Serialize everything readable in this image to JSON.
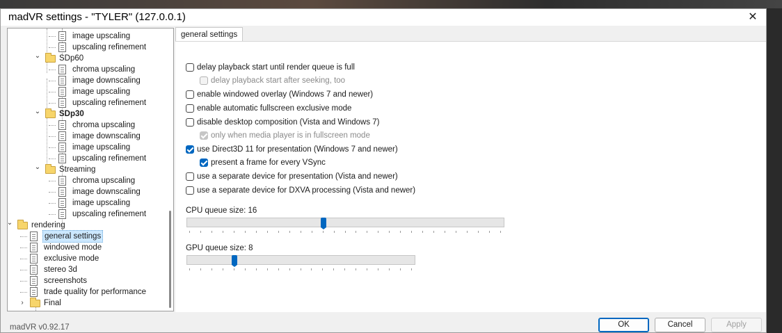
{
  "window": {
    "title": "madVR settings - \"TYLER\" (127.0.0.1)"
  },
  "icons": {
    "close": "close-icon",
    "folder": "folder-icon",
    "document": "document-icon",
    "expand": "chevron-down-icon",
    "collapsed": "chevron-right-icon"
  },
  "tree": {
    "items": [
      {
        "label": "image upscaling",
        "kind": "doc"
      },
      {
        "label": "upscaling refinement",
        "kind": "doc"
      },
      {
        "label": "SDp60",
        "kind": "folder",
        "expanded": true
      },
      {
        "label": "chroma upscaling",
        "kind": "doc"
      },
      {
        "label": "image downscaling",
        "kind": "doc"
      },
      {
        "label": "image upscaling",
        "kind": "doc"
      },
      {
        "label": "upscaling refinement",
        "kind": "doc"
      },
      {
        "label": "SDp30",
        "kind": "folder",
        "expanded": true,
        "bold": true
      },
      {
        "label": "chroma upscaling",
        "kind": "doc"
      },
      {
        "label": "image downscaling",
        "kind": "doc"
      },
      {
        "label": "image upscaling",
        "kind": "doc"
      },
      {
        "label": "upscaling refinement",
        "kind": "doc"
      },
      {
        "label": "Streaming",
        "kind": "folder",
        "expanded": true
      },
      {
        "label": "chroma upscaling",
        "kind": "doc"
      },
      {
        "label": "image downscaling",
        "kind": "doc"
      },
      {
        "label": "image upscaling",
        "kind": "doc"
      },
      {
        "label": "upscaling refinement",
        "kind": "doc"
      },
      {
        "label": "rendering",
        "kind": "folder",
        "expanded": true
      },
      {
        "label": "general settings",
        "kind": "doc",
        "selected": true
      },
      {
        "label": "windowed mode",
        "kind": "doc"
      },
      {
        "label": "exclusive mode",
        "kind": "doc"
      },
      {
        "label": "stereo 3d",
        "kind": "doc"
      },
      {
        "label": "screenshots",
        "kind": "doc"
      },
      {
        "label": "trade quality for performance",
        "kind": "doc"
      },
      {
        "label": "Final",
        "kind": "folder",
        "expanded": false
      }
    ]
  },
  "tab": {
    "label": "general settings"
  },
  "options": [
    {
      "label": "delay playback start until render queue is full",
      "checked": false,
      "disabled": false
    },
    {
      "label": "delay playback start after seeking, too",
      "checked": false,
      "disabled": true
    },
    {
      "label": "enable windowed overlay (Windows 7 and newer)",
      "checked": false,
      "disabled": false
    },
    {
      "label": "enable automatic fullscreen exclusive mode",
      "checked": false,
      "disabled": false
    },
    {
      "label": "disable desktop composition (Vista and Windows 7)",
      "checked": false,
      "disabled": false
    },
    {
      "label": "only when media player is in fullscreen mode",
      "checked": true,
      "disabled": true
    },
    {
      "label": "use Direct3D 11 for presentation (Windows 7 and newer)",
      "checked": true,
      "disabled": false
    },
    {
      "label": "present a frame for every VSync",
      "checked": true,
      "disabled": false
    },
    {
      "label": "use a separate device for presentation (Vista and newer)",
      "checked": false,
      "disabled": false
    },
    {
      "label": "use a separate device for DXVA processing (Vista and newer)",
      "checked": false,
      "disabled": false
    }
  ],
  "cpu_queue": {
    "label": "CPU queue size: 16",
    "value": 16,
    "min": 4,
    "max": 32
  },
  "gpu_queue": {
    "label": "GPU queue size: 8",
    "value": 8,
    "min": 4,
    "max": 24
  },
  "footer": {
    "version": "madVR v0.92.17",
    "ok": "OK",
    "cancel": "Cancel",
    "apply": "Apply"
  },
  "colors": {
    "accent": "#0067c0",
    "selection": "#cce8ff",
    "folder": "#f7d56b"
  }
}
